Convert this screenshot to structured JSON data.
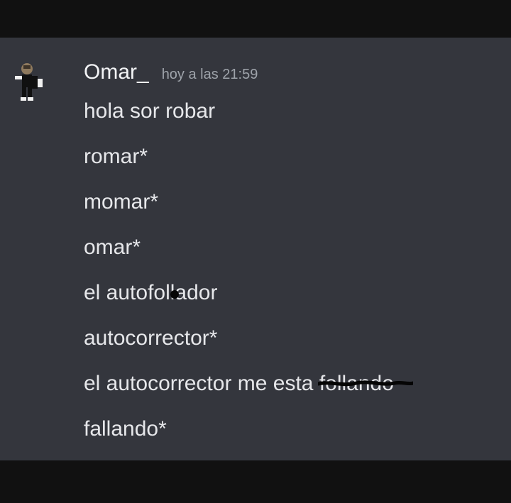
{
  "message": {
    "author": "Omar_",
    "timestamp": "hoy a las 21:59",
    "lines": [
      "hola sor robar",
      "romar*",
      "momar*",
      "omar*",
      "el autofollador",
      "autocorrector*",
      "el autocorrector me esta ",
      "fallando*"
    ],
    "crossed_word": "follando"
  },
  "colors": {
    "panel_background": "#34363d",
    "outer_background": "#111111",
    "username_color": "#f2f3f5",
    "timestamp_color": "#9ea3aa",
    "message_text_color": "#e6e7ea"
  },
  "icons": {
    "avatar": "roblox-avatar-icon",
    "scribble": "scribble-strike-icon",
    "cursor": "cursor-dot"
  }
}
